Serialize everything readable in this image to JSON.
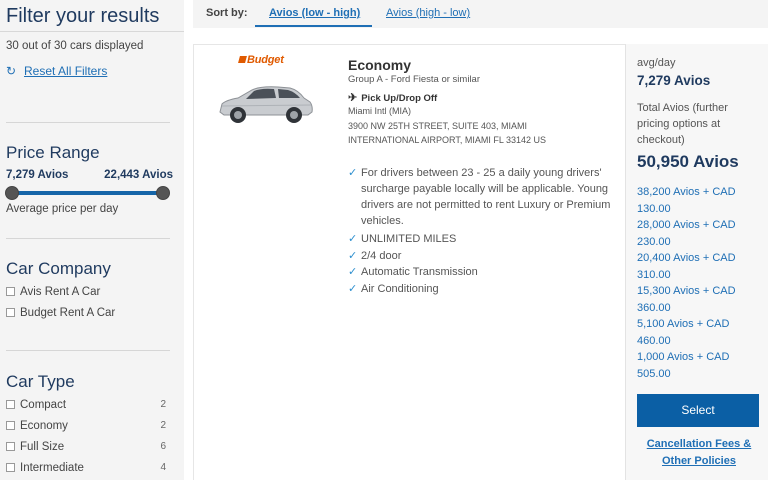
{
  "sidebar": {
    "title": "Filter your results",
    "count_text": "30 out of 30 cars displayed",
    "reset_label": "Reset All Filters",
    "price_range": {
      "title": "Price Range",
      "min": "7,279 Avios",
      "max": "22,443 Avios",
      "caption": "Average price per day"
    },
    "car_company": {
      "title": "Car Company",
      "items": [
        {
          "label": "Avis Rent A Car"
        },
        {
          "label": "Budget Rent A Car"
        }
      ]
    },
    "car_type": {
      "title": "Car Type",
      "items": [
        {
          "label": "Compact",
          "count": "2"
        },
        {
          "label": "Economy",
          "count": "2"
        },
        {
          "label": "Full Size",
          "count": "6"
        },
        {
          "label": "Intermediate",
          "count": "4"
        }
      ]
    }
  },
  "sort": {
    "label": "Sort by:",
    "options": [
      "Avios (low - high)",
      "Avios (high - low)"
    ],
    "active": "Avios (low - high)"
  },
  "result": {
    "brand": "Budget",
    "car_class": "Economy",
    "group": "Group A - Ford Fiesta or similar",
    "pickup_label": "Pick Up/Drop Off",
    "location_lines": [
      "Miami Intl (MIA)",
      "3900 NW 25TH STREET, SUITE 403, MIAMI",
      "INTERNATIONAL AIRPORT, MIAMI FL 33142 US"
    ],
    "features": [
      "For drivers between 23 - 25 a daily young drivers' surcharge payable locally will be applicable. Young drivers are not permitted to rent Luxury or Premium vehicles.",
      "UNLIMITED MILES",
      "2/4 door",
      "Automatic Transmission",
      "Air Conditioning"
    ],
    "pricing": {
      "avg_day_label": "avg/day",
      "avg_day_value": "7,279 Avios",
      "total_label": "Total Avios (further pricing options at checkout)",
      "total_value": "50,950 Avios",
      "options": [
        {
          "line1": "38,200 Avios + CAD",
          "line2": "130.00"
        },
        {
          "line1": "28,000 Avios + CAD",
          "line2": "230.00"
        },
        {
          "line1": "20,400 Avios + CAD",
          "line2": "310.00"
        },
        {
          "line1": "15,300 Avios + CAD",
          "line2": "360.00"
        },
        {
          "line1": "5,100 Avios + CAD",
          "line2": "460.00"
        },
        {
          "line1": "1,000 Avios + CAD",
          "line2": "505.00"
        }
      ],
      "select_label": "Select",
      "policy_link": "Cancellation Fees & Other Policies"
    }
  },
  "colors": {
    "navy": "#1f3a5f",
    "link_blue": "#1f6fb5",
    "button_blue": "#0b5fa5",
    "brand_orange": "#e05a00",
    "check_blue": "#2d8fcf"
  }
}
